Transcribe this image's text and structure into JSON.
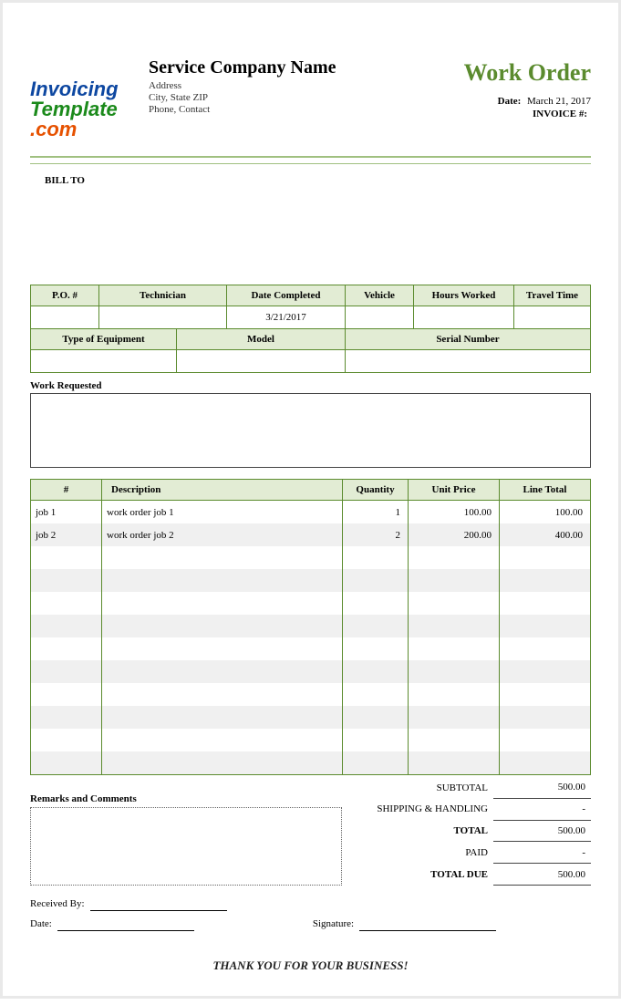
{
  "logo": {
    "top": "Invoicing",
    "mid": "Template",
    "bot": ".com"
  },
  "company": {
    "name": "Service Company Name",
    "address": "Address",
    "city_state_zip": "City, State ZIP",
    "phone": "Phone, Contact"
  },
  "title": "Work Order",
  "meta": {
    "date_label": "Date:",
    "date_value": "March 21, 2017",
    "invoice_label": "INVOICE #:",
    "invoice_value": ""
  },
  "bill_to_label": "BILL TO",
  "job_headers1": [
    "P.O. #",
    "Technician",
    "Date Completed",
    "Vehicle",
    "Hours Worked",
    "Travel Time"
  ],
  "job_row1": [
    "",
    "",
    "3/21/2017",
    "",
    "",
    ""
  ],
  "job_headers2": [
    "Type of Equipment",
    "Model",
    "Serial Number"
  ],
  "job_row2": [
    "",
    "",
    ""
  ],
  "work_requested_label": "Work Requested",
  "items_headers": {
    "num": "#",
    "desc": "Description",
    "qty": "Quantity",
    "price": "Unit Price",
    "total": "Line Total"
  },
  "items": [
    {
      "num": "job 1",
      "desc": "work order job 1",
      "qty": "1",
      "price": "100.00",
      "total": "100.00"
    },
    {
      "num": "job 2",
      "desc": "work order job 2",
      "qty": "2",
      "price": "200.00",
      "total": "400.00"
    },
    {
      "num": "",
      "desc": "",
      "qty": "",
      "price": "",
      "total": ""
    },
    {
      "num": "",
      "desc": "",
      "qty": "",
      "price": "",
      "total": ""
    },
    {
      "num": "",
      "desc": "",
      "qty": "",
      "price": "",
      "total": ""
    },
    {
      "num": "",
      "desc": "",
      "qty": "",
      "price": "",
      "total": ""
    },
    {
      "num": "",
      "desc": "",
      "qty": "",
      "price": "",
      "total": ""
    },
    {
      "num": "",
      "desc": "",
      "qty": "",
      "price": "",
      "total": ""
    },
    {
      "num": "",
      "desc": "",
      "qty": "",
      "price": "",
      "total": ""
    },
    {
      "num": "",
      "desc": "",
      "qty": "",
      "price": "",
      "total": ""
    },
    {
      "num": "",
      "desc": "",
      "qty": "",
      "price": "",
      "total": ""
    },
    {
      "num": "",
      "desc": "",
      "qty": "",
      "price": "",
      "total": ""
    }
  ],
  "remarks_label": "Remarks and Comments",
  "totals": {
    "subtotal_label": "SUBTOTAL",
    "subtotal": "500.00",
    "shipping_label": "SHIPPING & HANDLING",
    "shipping": "-",
    "total_label": "TOTAL",
    "total": "500.00",
    "paid_label": "PAID",
    "paid": "-",
    "due_label": "TOTAL DUE",
    "due": "500.00"
  },
  "sign": {
    "received_by": "Received By:",
    "date": "Date:",
    "signature": "Signature:"
  },
  "thank_you": "THANK YOU FOR YOUR BUSINESS!"
}
